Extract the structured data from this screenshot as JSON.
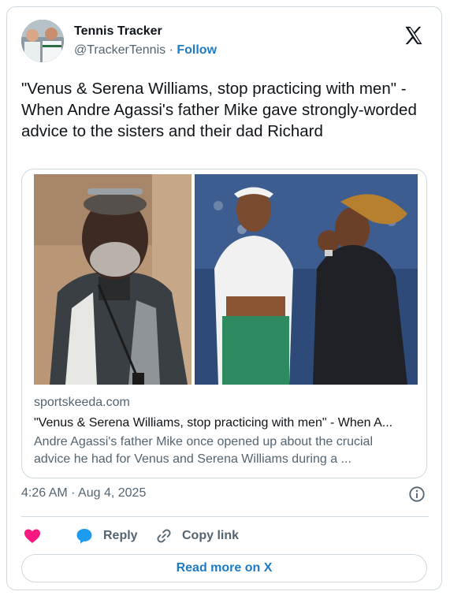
{
  "author": {
    "name": "Tennis Tracker",
    "handle": "@TrackerTennis",
    "separator": "·",
    "follow_label": "Follow"
  },
  "tweet": {
    "text": "\"Venus & Serena Williams, stop practicing with men\" - When Andre Agassi's father Mike gave strongly-worded advice to the sisters and their dad Richard"
  },
  "link_card": {
    "domain": "sportskeeda.com",
    "title": "\"Venus & Serena Williams, stop practicing with men\" - When A...",
    "description": "Andre Agassi's father Mike once opened up about the crucial advice he had for Venus and Serena Williams during a ..."
  },
  "timestamp": "4:26 AM · Aug 4, 2025",
  "actions": {
    "like_icon": "heart-icon",
    "reply_label": "Reply",
    "copy_label": "Copy link"
  },
  "read_more_label": "Read more on X",
  "colors": {
    "accent": "#1d7bc3",
    "like": "#f91880",
    "reply": "#1d9bf0",
    "muted": "#536471",
    "border": "#cfd9de"
  }
}
